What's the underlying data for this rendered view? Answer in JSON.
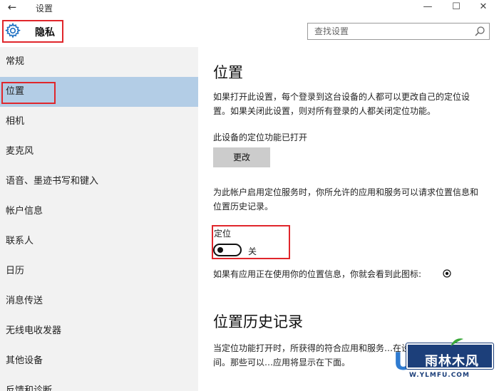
{
  "window": {
    "title": "设置",
    "back_icon": "arrow-left-icon",
    "minimize_glyph": "—",
    "maximize_glyph": "☐",
    "close_glyph": "✕"
  },
  "header": {
    "section_title": "隐私",
    "section_icon": "gear-icon",
    "search_placeholder": "查找设置"
  },
  "sidebar": {
    "items": [
      {
        "label": "常规",
        "active": false
      },
      {
        "label": "位置",
        "active": true
      },
      {
        "label": "相机",
        "active": false
      },
      {
        "label": "麦克风",
        "active": false
      },
      {
        "label": "语音、墨迹书写和键入",
        "active": false
      },
      {
        "label": "帐户信息",
        "active": false
      },
      {
        "label": "联系人",
        "active": false
      },
      {
        "label": "日历",
        "active": false
      },
      {
        "label": "消息传送",
        "active": false
      },
      {
        "label": "无线电收发器",
        "active": false
      },
      {
        "label": "其他设备",
        "active": false
      },
      {
        "label": "反馈和诊断",
        "active": false
      }
    ]
  },
  "main": {
    "title": "位置",
    "description": "如果打开此设置，每个登录到这台设备的人都可以更改自己的定位设置。如果关闭此设置，则对所有登录的人都关闭定位功能。",
    "device_status": "此设备的定位功能已打开",
    "change_button": "更改",
    "account_description": "为此帐户启用定位服务时，你所允许的应用和服务可以请求位置信息和位置历史记录。",
    "location_label": "定位",
    "location_state": "关",
    "location_on": false,
    "in_use_text": "如果有应用正在使用你的位置信息，你就会看到此图标:",
    "in_use_icon": "location-target-icon",
    "history_title": "位置历史记录",
    "history_description": "当定位功能打开时，所获得的符合应用和服务…在设备上存储一定的时间。那些可以…应用将显示在下面。"
  },
  "watermark": {
    "logo_text": "雨林木风",
    "url": "W.YLMFU.COM"
  },
  "colors": {
    "highlight_red": "#e0262b",
    "sidebar_bg": "#f2f2f2",
    "active_item_bg": "#b3cde6",
    "button_bg": "#cccccc"
  }
}
